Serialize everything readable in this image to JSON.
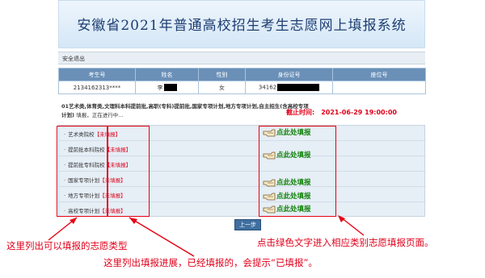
{
  "header": {
    "title": "安徽省2021年普通高校招生考生志愿网上填报系统"
  },
  "topbar": {
    "logout_label": "安全退出"
  },
  "info_table": {
    "columns": [
      "考生号",
      "姓名",
      "性别",
      "身份证号",
      "座位号"
    ],
    "row": {
      "exam_id": "2134162313****",
      "name": "李",
      "gender": "女",
      "id_number": "34162",
      "seat": ""
    }
  },
  "notice": {
    "text": "01艺术类,体育类,文理科本科提前批,高职(专科)提前批,国家专项计划,地方专项计划,自主招生(含高校专项计划)",
    "status": "填报，正在进行中…",
    "deadline_label": "截止时间:",
    "deadline_value": "2021-06-29 19:00:00"
  },
  "volunteers": [
    {
      "label": "艺术类院校",
      "status": "【未填报】"
    },
    {
      "label": "提前批本科院校",
      "status": "【未填报】"
    },
    {
      "label": "提前批专科院校",
      "status": "【未填报】"
    },
    {
      "label": "国家专项计划",
      "status": "【未填报】"
    },
    {
      "label": "地方专项计划",
      "status": "【未填报】"
    },
    {
      "label": "高校专项计划",
      "status": "【未填报】"
    }
  ],
  "links": [
    {
      "label": "点此处填报"
    },
    {
      "label": "点此处填报"
    },
    {
      "label": "点此处填报"
    },
    {
      "label": "点此处填报"
    },
    {
      "label": "点此处填报"
    }
  ],
  "buttons": {
    "prev_label": "上一步"
  },
  "annotations": {
    "left": "这里列出可以填报的志愿类型",
    "right": "点击绿色文字进入相应类别志愿填报页面。",
    "bottom": "这里列出填报进展，已经填报的，会提示“已填报”。"
  },
  "colors": {
    "annotation": "#e0001a",
    "link": "#12820c",
    "header_bg": "#6a90b8"
  }
}
